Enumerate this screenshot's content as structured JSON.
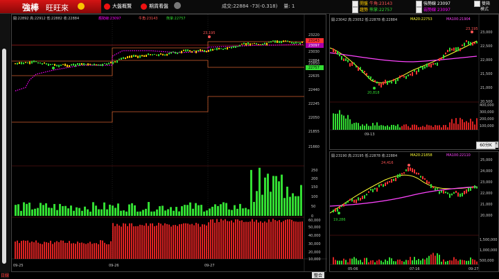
{
  "app": {
    "brand_name": "強棒",
    "brand_sub": "旺旺來"
  },
  "toolbar": {
    "btn1": "大盤概覽",
    "btn2": "期貨看盤"
  },
  "quote": {
    "volume_label": "成交:22884",
    "change": "-73(-0.318)",
    "qty_label": "量: 1"
  },
  "indicators": [
    {
      "label": "開盤",
      "value": "牛角:23143",
      "checked": true
    },
    {
      "label": "趨勢",
      "value": "熊掌:22757",
      "checked": true
    },
    {
      "label": "",
      "value": "強勢線 23097",
      "checked": true
    },
    {
      "label": "",
      "value": "弱勢線 23097",
      "checked": true
    },
    {
      "label": "雙箱",
      "value": "",
      "checked": false
    },
    {
      "label": "模式",
      "value": "",
      "checked": false
    }
  ],
  "main_chart": {
    "header": "開:22892 高:22912 低:22882 收:22884",
    "legends": [
      "趨勢線:23097",
      "牛角:23143",
      "熊掌:22757"
    ],
    "annotation_high": "23,195",
    "price_ticks": [
      "23220",
      "23143",
      "23097",
      "23030",
      "22884",
      "22850",
      "22757",
      "22635",
      "22440",
      "22245",
      "22050",
      "21855",
      "21660"
    ],
    "vol1_ticks": [
      "250",
      "200",
      "150",
      "100",
      "50",
      "0"
    ],
    "vol2_ticks": [
      "60,000",
      "50,000",
      "40,000",
      "30,000",
      "20,000",
      "10,000"
    ],
    "dates": [
      "09-25",
      "09-26",
      "09-27"
    ],
    "colors": {
      "bull": "#ffcc00",
      "bear": "#ff3333",
      "trend": "#ff00ff",
      "price_box": "#d4622f",
      "up_bar": "#33dd33",
      "down_bar": "#dd2222"
    }
  },
  "chart_r1": {
    "header": "開:23042 高:23052 低:22878 收:22884",
    "ma20": "MA20:22753",
    "ma100": "MA100:21904",
    "annotation_high": "23,195",
    "annotation_low": "20,818",
    "price_ticks": [
      "23,000",
      "22,500",
      "22,000",
      "21,500",
      "21,000",
      "20,500"
    ],
    "vol_ticks": [
      "400,000",
      "300,000",
      "200,000",
      "100,000"
    ],
    "dates": [
      "09-13"
    ],
    "period_button": "60分K"
  },
  "chart_r2": {
    "header": "開:23190 高:23195 低:22878 收:22884",
    "ma20": "MA20:21858",
    "ma100": "MA100:22110",
    "annotation_high": "24,416",
    "annotation_low": "19,286",
    "price_ticks": [
      "25,000",
      "24,000",
      "23,000",
      "22,000",
      "21,000",
      "20,000"
    ],
    "vol_ticks": [
      "1,500,000",
      "1,000,000",
      "500,000"
    ],
    "dates": [
      "05-06",
      "07-16",
      "09-27"
    ]
  },
  "statusbar": {
    "left": "日線",
    "buttons": [
      "整合"
    ]
  }
}
